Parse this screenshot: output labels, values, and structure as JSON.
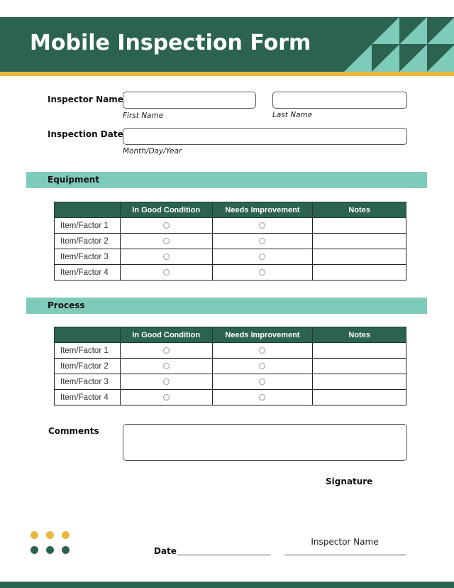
{
  "header": {
    "title": "Mobile Inspection Form"
  },
  "colors": {
    "primary": "#2b6350",
    "accent_teal": "#7fcbb9",
    "accent_gold": "#e8b83e"
  },
  "inspector": {
    "label": "Inspector Name",
    "first_name": {
      "value": "",
      "hint": "First Name"
    },
    "last_name": {
      "value": "",
      "hint": "Last Name"
    }
  },
  "inspection_date": {
    "label": "Inspection Date",
    "value": "",
    "hint": "Month/Day/Year"
  },
  "sections": [
    {
      "title": "Equipment",
      "columns": [
        "",
        "In Good Condition",
        "Needs Improvement",
        "Notes"
      ],
      "rows": [
        {
          "item": "Item/Factor 1",
          "good": false,
          "needs_improvement": false,
          "notes": ""
        },
        {
          "item": "Item/Factor 2",
          "good": false,
          "needs_improvement": false,
          "notes": ""
        },
        {
          "item": "Item/Factor 3",
          "good": false,
          "needs_improvement": false,
          "notes": ""
        },
        {
          "item": "Item/Factor 4",
          "good": false,
          "needs_improvement": false,
          "notes": ""
        }
      ]
    },
    {
      "title": "Process",
      "columns": [
        "",
        "In Good Condition",
        "Needs Improvement",
        "Notes"
      ],
      "rows": [
        {
          "item": "Item/Factor 1",
          "good": false,
          "needs_improvement": false,
          "notes": ""
        },
        {
          "item": "Item/Factor 2",
          "good": false,
          "needs_improvement": false,
          "notes": ""
        },
        {
          "item": "Item/Factor 3",
          "good": false,
          "needs_improvement": false,
          "notes": ""
        },
        {
          "item": "Item/Factor 4",
          "good": false,
          "needs_improvement": false,
          "notes": ""
        }
      ]
    }
  ],
  "comments": {
    "label": "Comments",
    "value": ""
  },
  "signature": {
    "heading": "Signature",
    "date_label": "Date",
    "name_caption": "Inspector Name"
  }
}
